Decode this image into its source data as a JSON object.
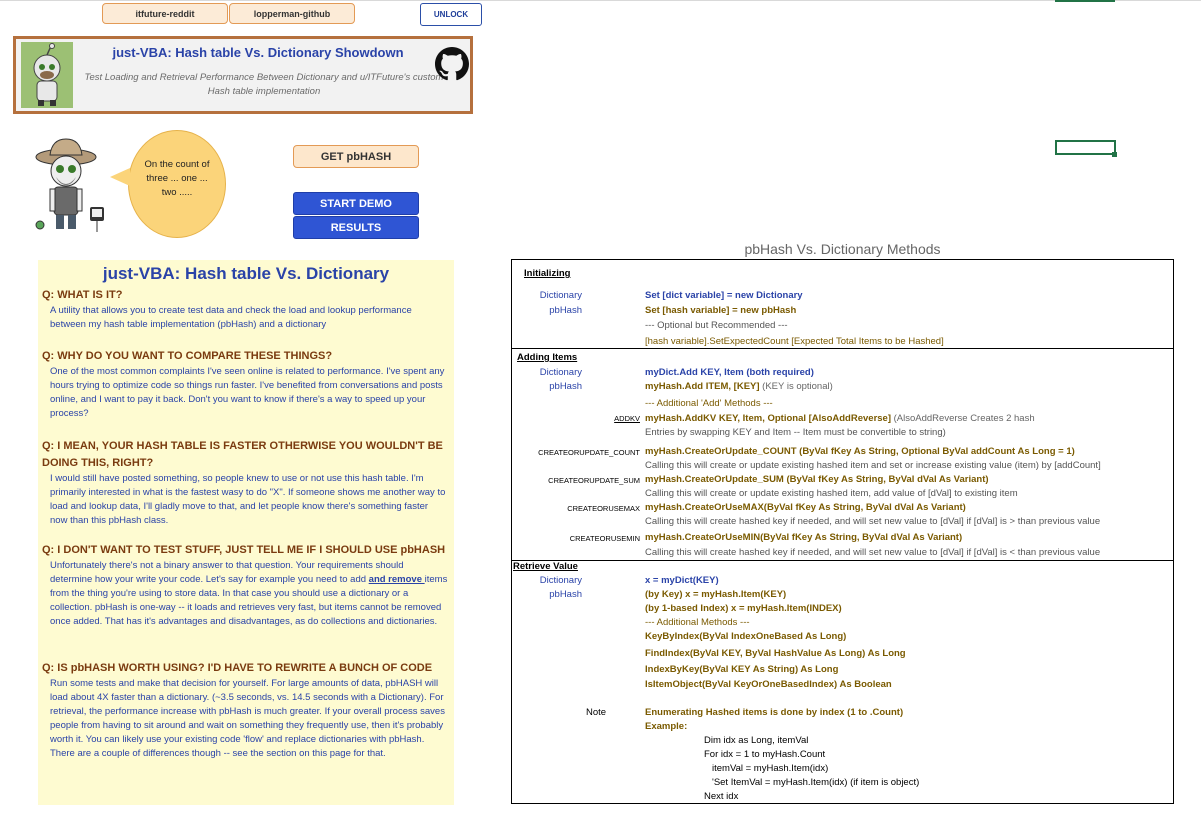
{
  "toolbar": {
    "tab1": "itfuture-reddit",
    "tab2": "lopperman-github",
    "unlock": "UNLOCK"
  },
  "banner": {
    "title": "just-VBA: Hash table Vs. Dictionary Showdown",
    "subtitle": "Test Loading and Retrieval Performance Between Dictionary and u/ITFuture's custom Hash table implementation"
  },
  "bubble": {
    "text": "On the count of three ... one ... two ....."
  },
  "buttons": {
    "get": "GET pbHASH",
    "start": "START DEMO",
    "results": "RESULTS"
  },
  "faq": {
    "title": "just-VBA: Hash table Vs. Dictionary",
    "items": [
      {
        "q": "Q: WHAT IS IT?",
        "a": "A utility that allows you to create test data and check the load and lookup performance between my hash table implementation (pbHash) and a dictionary"
      },
      {
        "q": "Q: WHY DO YOU WANT TO COMPARE THESE THINGS?",
        "a": "One of the most common complaints I've seen online is related to performance. I've spent any hours trying to optimize code so things run faster.  I've benefited from conversations and posts online, and I want to pay it back.  Don't you want to know if there's a way to speed up your process?"
      },
      {
        "q": "Q: I MEAN, YOUR HASH TABLE IS FASTER OTHERWISE YOU WOULDN'T BE DOING THIS, RIGHT?",
        "a": "I would still have posted something, so people knew to use or not use this hash table. I'm primarily interested in what is the fastest wasy to do \"X\".  If someone shows me another way to load and lookup data, I'll gladly move to that, and let people know there's something faster now than this pbHash class."
      },
      {
        "q": "Q: I DON'T WANT TO TEST STUFF, JUST TELL ME IF I SHOULD USE pbHASH",
        "a1": "Unfortunately there's not a binary answer to that question.  Your requirements should determine how your write your code.  Let's say for example you need to add ",
        "a_u": "and remove ",
        "a2": "items from the thing you're using to store data. In that case you should use a dictionary or a collection.  pbHash is one-way -- it loads and retrieves very fast, but items cannot be removed once added.  That has it's advantages and disadvantages, as do collections and dictionaries."
      },
      {
        "q": "Q: IS pbHASH WORTH USING? I'D HAVE TO REWRITE A BUNCH OF CODE",
        "a": "Run some tests and make that decision for yourself.  For large amounts of data, pbHASH will load about 4X faster than a dictionary. (~3.5 seconds, vs. 14.5 seconds with a Dictionary).  For retrieval, the performance increase with pbHash is much greater.  If your overall process saves people from having to sit around and wait on something they frequently use, then it's probably worth it.  You can likely use your existing code 'flow' and replace dictionaries with pbHash.  There are a couple of differences though -- see the section on this page for that."
      }
    ]
  },
  "methods": {
    "title": "pbHash Vs. Dictionary Methods",
    "init": {
      "header": "Initializing",
      "dict_label": "Dictionary",
      "dict_code": "Set [dict variable] = new Dictionary",
      "hash_label": "pbHash",
      "hash_code": "Set [hash variable] = new pbHash",
      "note": "--- Optional but Recommended ---",
      "expected": "[hash variable].SetExpectedCount [Expected Total Items to be Hashed]"
    },
    "add": {
      "header": "Adding Items",
      "dict_label": "Dictionary",
      "dict_code": "myDict.Add KEY, Item (both required)",
      "hash_label": "pbHash",
      "hash_code": "myHash.Add ITEM, [KEY]",
      "hash_note": " (KEY is optional)",
      "additional": "--- Additional 'Add' Methods ---",
      "addkv_label": "ADDKV",
      "addkv_code": "myHash.AddKV KEY, Item, Optional [AlsoAddReverse]",
      "addkv_note": " (AlsoAddReverse Creates 2 hash",
      "addkv_desc": "Entries by swapping KEY and Item  -- Item must be convertible to string)",
      "count_label": "CREATEORUPDATE_COUNT",
      "count_code": "myHash.CreateOrUpdate_COUNT (ByVal fKey As String, Optional ByVal addCount As Long = 1)",
      "count_desc": "Calling this will create or update existing hashed item and set or increase existing value (item) by [addCount]",
      "sum_label": "CREATEORUPDATE_SUM",
      "sum_code": "myHash.CreateOrUpdate_SUM (ByVal fKey As String, ByVal dVal As Variant)",
      "sum_desc": "Calling this will create or update existing hashed item, add value of [dVal] to existing item",
      "max_label": "CREATEORUSEMAX",
      "max_code": "myHash.CreateOrUseMAX(ByVal fKey As String, ByVal dVal As Variant)",
      "max_desc": "Calling this will create hashed key if needed, and will set new value to [dVal] if [dVal] is > than previous value",
      "min_label": "CREATEORUSEMIN",
      "min_code": "myHash.CreateOrUseMIN(ByVal fKey As String, ByVal dVal As Variant)",
      "min_desc": "Calling this will create hashed key if needed, and will set new value to [dVal] if [dVal] is < than previous value"
    },
    "retrieve": {
      "header": "Retrieve Value",
      "dict_label": "Dictionary",
      "dict_code": "x = myDict(KEY)",
      "hash_label": "pbHash",
      "hash_code1": "(by Key) x = myHash.Item(KEY)",
      "hash_code2": "(by 1-based Index) x = myHash.Item(INDEX)",
      "additional": "--- Additional  Methods ---",
      "m1": "KeyByIndex(ByVal IndexOneBased As Long)",
      "m2": "FindIndex(ByVal KEY, ByVal HashValue As Long) As Long",
      "m3": "IndexByKey(ByVal KEY As String) As Long",
      "m4": "IsItemObject(ByVal KeyOrOneBasedIndex) As Boolean",
      "note_label": "Note",
      "note_code": "Enumerating Hashed items is done by index (1 to .Count)",
      "example": "Example:",
      "ex1": "Dim idx as Long, itemVal",
      "ex2": "For idx = 1 to myHash.Count",
      "ex3": "itemVal = myHash.Item(idx)",
      "ex4": "'Set ItemVal = myHash.Item(idx) (if item is object)",
      "ex5": "Next idx"
    }
  }
}
